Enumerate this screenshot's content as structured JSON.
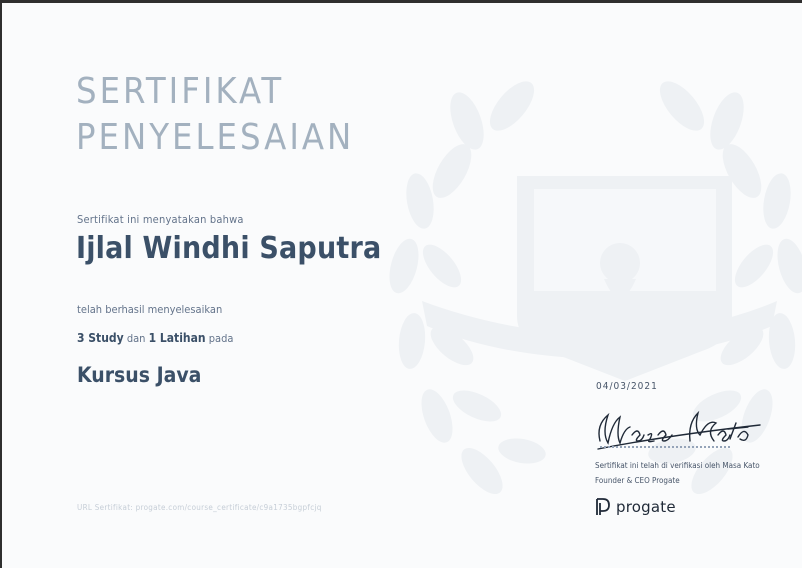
{
  "certificate": {
    "title_line1": "SERTIFIKAT",
    "title_line2": "PENYELESAIAN",
    "statement": "Sertifikat ini menyatakan bahwa",
    "recipient_name": "Ijlal Windhi Saputra",
    "completed_text": "telah berhasil menyelesaikan",
    "study_count": "3 Study",
    "and_word": "dan",
    "exercise_count": "1 Latihan",
    "on_word": "pada",
    "course_name": "Kursus Java",
    "url": "URL Sertifikat: progate.com/course_certificate/c9a1735bgpfcjq"
  },
  "signature_block": {
    "date": "04/03/2021",
    "signature_text": "Masa Kato",
    "verified_by": "Sertifikat ini telah di verifikasi oleh Masa Kato",
    "role": "Founder & CEO Progate",
    "logo_text": "progate"
  },
  "colors": {
    "title": "#a3b1bf",
    "name": "#3b5068",
    "emblem": "#eef1f4"
  }
}
